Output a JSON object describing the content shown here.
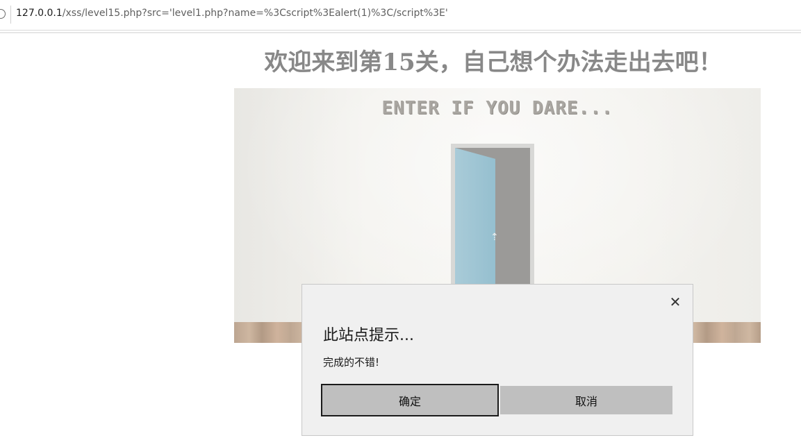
{
  "browser": {
    "url_host": "127.0.0.1",
    "url_path": "/xss/level15.php?src='level1.php?name=%3Cscript%3Ealert(1)%3C/script%3E'"
  },
  "page": {
    "title": "欢迎来到第15关，自己想个办法走出去吧！",
    "image_banner": "ENTER IF YOU DARE..."
  },
  "dialog": {
    "heading": "此站点提示...",
    "message": "完成的不错!",
    "ok_label": "确定",
    "cancel_label": "取消",
    "close_glyph": "✕"
  },
  "colors": {
    "dialog_bg": "#f0f0f0",
    "button_bg": "#bfbfbf",
    "door_blue": "#a9cbd8",
    "title_gray": "#888888"
  }
}
